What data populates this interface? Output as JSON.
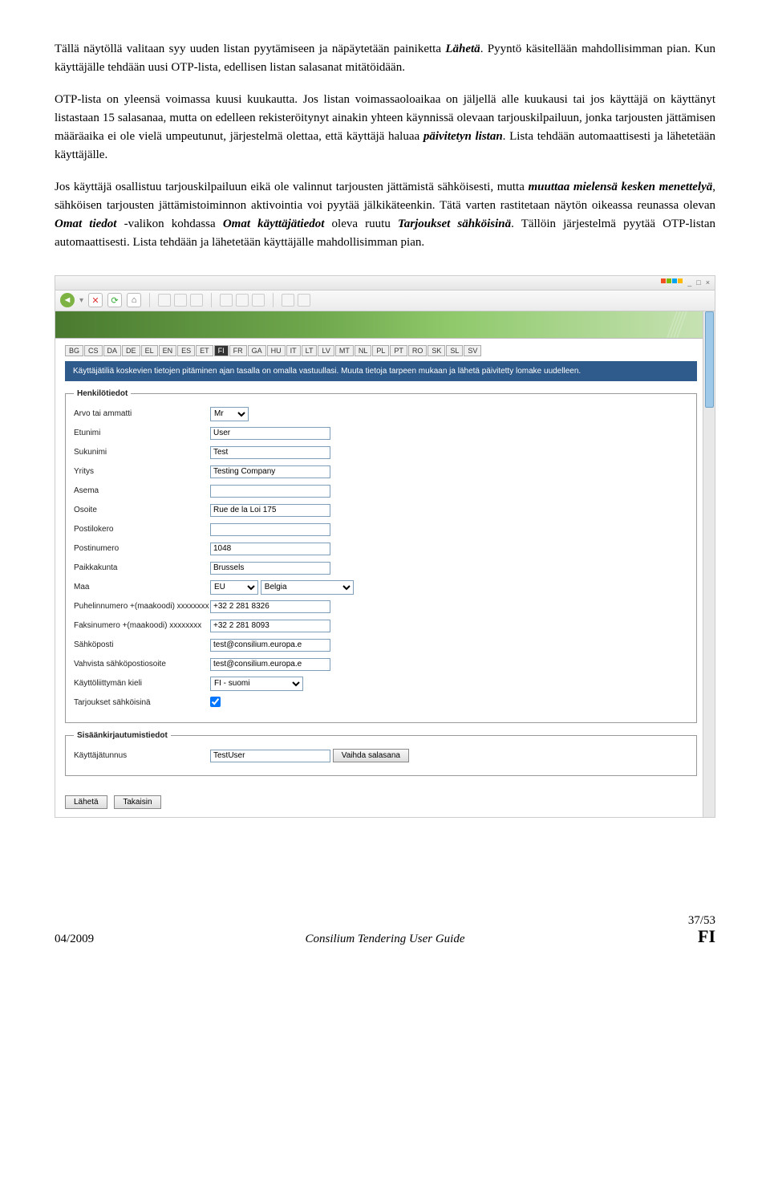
{
  "doc": {
    "p1_a": "Tällä näytöllä valitaan syy uuden listan pyytämiseen ja näpäytetään painiketta ",
    "p1_b": "Lähetä",
    "p1_c": ". Pyyntö käsitellään mahdollisimman pian. Kun käyttäjälle tehdään uusi OTP-lista, edellisen listan salasanat mitätöidään.",
    "p2_a": "OTP-lista on yleensä voimassa kuusi kuukautta. Jos listan voimassaoloaikaa on jäljellä alle kuukausi tai jos käyttäjä on käyttänyt listastaan 15 salasanaa, mutta on edelleen rekisteröitynyt ainakin yhteen käynnissä olevaan tarjouskilpailuun, jonka tarjousten jättämisen määräaika ei ole vielä umpeutunut, järjestelmä olettaa, että käyttäjä haluaa ",
    "p2_b": "päivitetyn listan",
    "p2_c": ". Lista tehdään automaattisesti ja lähetetään käyttäjälle.",
    "p3_a": "Jos käyttäjä osallistuu tarjouskilpailuun eikä ole valinnut tarjousten jättämistä sähköisesti, mutta ",
    "p3_b": "muuttaa mielensä kesken menettelyä",
    "p3_c": ", sähköisen tarjousten jättämistoiminnon aktivointia voi pyytää jälkikäteenkin. Tätä varten rastitetaan näytön oikeassa reunassa olevan ",
    "p3_d": "Omat tiedot",
    "p3_e": " -valikon kohdassa ",
    "p3_f": "Omat käyttäjätiedot",
    "p3_g": " oleva ruutu ",
    "p3_h": "Tarjoukset sähköisinä",
    "p3_i": ". Tällöin järjestelmä pyytää OTP-listan automaattisesti. Lista tehdään ja lähetetään käyttäjälle mahdollisimman pian."
  },
  "langs": [
    "BG",
    "CS",
    "DA",
    "DE",
    "EL",
    "EN",
    "ES",
    "ET",
    "FI",
    "FR",
    "GA",
    "HU",
    "IT",
    "LT",
    "LV",
    "MT",
    "NL",
    "PL",
    "PT",
    "RO",
    "SK",
    "SL",
    "SV"
  ],
  "active_lang": "FI",
  "notice": "Käyttäjätiliä koskevien tietojen pitäminen ajan tasalla on omalla vastuullasi. Muuta tietoja tarpeen mukaan ja lähetä päivitetty lomake uudelleen.",
  "form": {
    "legend_personal": "Henkilötiedot",
    "labels": {
      "title": "Arvo tai ammatti",
      "firstname": "Etunimi",
      "lastname": "Sukunimi",
      "company": "Yritys",
      "position": "Asema",
      "address": "Osoite",
      "pobox": "Postilokero",
      "postcode": "Postinumero",
      "city": "Paikkakunta",
      "country": "Maa",
      "phone": "Puhelinnumero +(maakoodi) xxxxxxxx",
      "fax": "Faksinumero +(maakoodi) xxxxxxxx",
      "email": "Sähköposti",
      "email2": "Vahvista sähköpostiosoite",
      "ui_lang": "Käyttöliittymän kieli",
      "etender": "Tarjoukset sähköisinä"
    },
    "values": {
      "title": "Mr",
      "firstname": "User",
      "lastname": "Test",
      "company": "Testing Company",
      "position": "",
      "address": "Rue de la Loi 175",
      "pobox": "",
      "postcode": "1048",
      "city": "Brussels",
      "country_code": "EU",
      "country_name": "Belgia",
      "phone": "+32 2 281 8326",
      "fax": "+32 2 281 8093",
      "email": "test@consilium.europa.e",
      "email2": "test@consilium.europa.e",
      "ui_lang": "FI - suomi"
    },
    "legend_login": "Sisäänkirjautumistiedot",
    "login": {
      "user_lbl": "Käyttäjätunnus",
      "user_val": "TestUser",
      "changepw": "Vaihda salasana"
    },
    "buttons": {
      "submit": "Lähetä",
      "back": "Takaisin"
    }
  },
  "footer": {
    "left": "04/2009",
    "center": "Consilium Tendering User Guide",
    "page": "37/53",
    "lang": "FI"
  }
}
